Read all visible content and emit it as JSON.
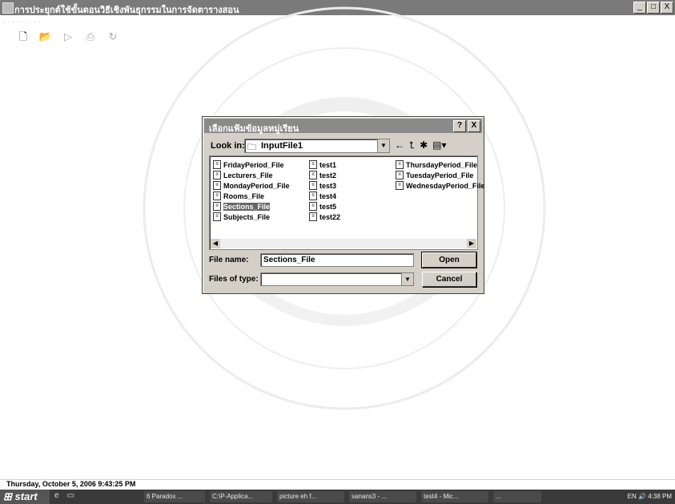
{
  "window": {
    "title": "การประยุกต์ใช้ขั้นตอนวิธีเชิงพันธุกรรมในการจัดตารางสอน",
    "controls": [
      "_",
      "□",
      "X"
    ]
  },
  "toolbar": {
    "icons": [
      "new-icon",
      "open-icon",
      "run-icon",
      "print-icon",
      "refresh-icon"
    ]
  },
  "dialog": {
    "title": "เลือกแฟ้มข้อมูลหมู่เรียน",
    "help": "?",
    "close": "X",
    "look_in_label": "Look in:",
    "look_in_value": "InputFile1",
    "files_col1": [
      "FridayPeriod_File",
      "Lecturers_File",
      "MondayPeriod_File",
      "Rooms_File",
      "Sections_File",
      "Subjects_File"
    ],
    "files_col2": [
      "test1",
      "test2",
      "test3",
      "test4",
      "test5",
      "test22"
    ],
    "files_col3": [
      "ThursdayPeriod_File",
      "TuesdayPeriod_File",
      "WednesdayPeriod_File"
    ],
    "selected_file": "Sections_File",
    "file_name_label": "File name:",
    "file_name_value": "Sections_File",
    "files_of_type_label": "Files of type:",
    "files_of_type_value": "",
    "open_label": "Open",
    "cancel_label": "Cancel"
  },
  "status": {
    "datetime": "Thursday, October 5, 2006   9:43:25 PM"
  },
  "taskbar": {
    "start": "start",
    "tasks": [
      "6 Paradox ...",
      "C:\\P-Applica...",
      "picture eh f...",
      "sanans3 - ...",
      "test4 - Mic...",
      "..."
    ],
    "tray_time": "4:38 PM",
    "tray_lang": "EN"
  },
  "colors": {
    "dialog_face": "#d4d0c8",
    "titlebar": "#7a7a7a",
    "taskbar": "#3a3a3a"
  }
}
